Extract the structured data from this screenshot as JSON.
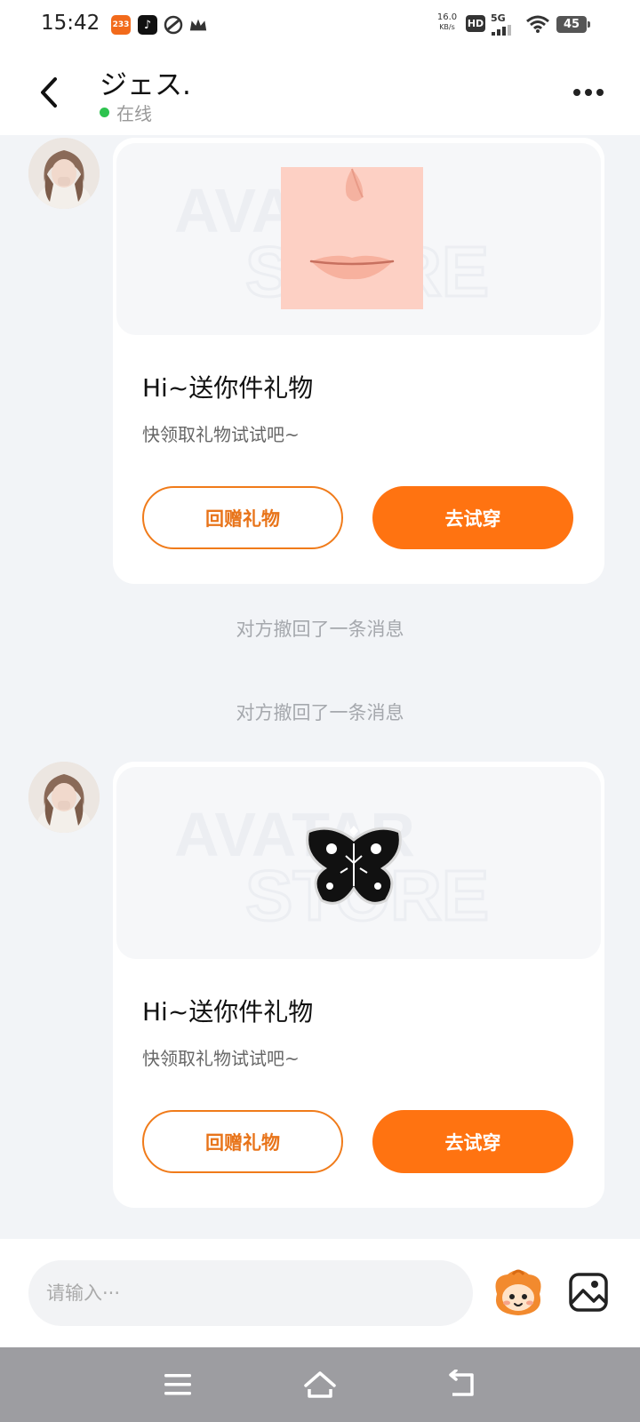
{
  "status_bar": {
    "time": "15:42",
    "apps": [
      {
        "name": "233-app-icon",
        "text": "233",
        "color": "#f26a1b"
      },
      {
        "name": "tiktok-icon",
        "text": "♪",
        "color": "#111111"
      },
      {
        "name": "leaf-app-icon",
        "text": "",
        "color": "#333333"
      },
      {
        "name": "crown-icon",
        "text": "",
        "color": "#333333"
      }
    ],
    "net_speed_value": "16.0",
    "net_speed_unit": "KB/s",
    "hd": "HD",
    "network": "5G",
    "battery": "45"
  },
  "header": {
    "title": "ジェス.",
    "status": "在线",
    "status_color": "#2ec34f"
  },
  "messages": [
    {
      "type": "gift",
      "watermark_line1": "AVATAR",
      "watermark_line2": "STORE",
      "gift_item": "face-lips-icon",
      "title": "Hi~送你件礼物",
      "subtitle": "快领取礼物试试吧~",
      "return_label": "回赠礼物",
      "try_label": "去试穿"
    },
    {
      "type": "system",
      "text": "对方撤回了一条消息"
    },
    {
      "type": "system",
      "text": "对方撤回了一条消息"
    },
    {
      "type": "gift",
      "watermark_line1": "AVATAR",
      "watermark_line2": "STORE",
      "gift_item": "butterfly-icon",
      "title": "Hi~送你件礼物",
      "subtitle": "快领取礼物试试吧~",
      "return_label": "回赠礼物",
      "try_label": "去试穿"
    }
  ],
  "input": {
    "placeholder": "请输入···",
    "value": ""
  },
  "colors": {
    "accent": "#ff7311",
    "accent_border": "#f07b1a",
    "chat_bg": "#f2f4f7"
  },
  "icons": {
    "back": "chevron-left-icon",
    "more": "more-dots-icon",
    "emoji": "mascot-emoji-icon",
    "image": "image-icon",
    "nav_menu": "menu-icon",
    "nav_home": "home-icon",
    "nav_back": "back-arrow-icon"
  }
}
